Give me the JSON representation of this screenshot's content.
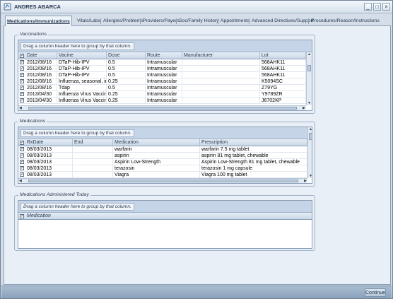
{
  "window": {
    "title": "ANDRES ABARCA",
    "minimize": "_",
    "maximize": "□",
    "close": "×"
  },
  "tabs": [
    {
      "label": "Medications/Immunizations",
      "active": true
    },
    {
      "label": "Vitals/Labs"
    },
    {
      "label": "Allergies/Problems"
    },
    {
      "label": "Providers/Payers"
    },
    {
      "label": "Soc/Family History"
    },
    {
      "label": "Appointments"
    },
    {
      "label": "Advanced Directives/Support"
    },
    {
      "label": "Procedures/Reason/Instructions"
    }
  ],
  "group_hint": "Drag a column header here to group by that column.",
  "vaccinations": {
    "title": "Vaccinations",
    "columns": [
      "Date",
      "Vacine",
      "Dose",
      "Route",
      "Manufacturer",
      "Lot"
    ],
    "rows": [
      [
        "2012/08/16",
        "DTaP-Hib-IPV",
        "0.5",
        "Intramuscular",
        "",
        "568AHK11"
      ],
      [
        "2012/08/16",
        "DTaP-Hib-IPV",
        "0.5",
        "Intramuscular",
        "",
        "568AHK11"
      ],
      [
        "2012/08/16",
        "DTaP-Hib-IPV",
        "0.5",
        "Intramuscular",
        "",
        "568AHK11"
      ],
      [
        "2012/08/16",
        "Influenza, seasonal, inje...",
        "0.25",
        "Intramuscular",
        "",
        "K5094SC"
      ],
      [
        "2012/08/16",
        "Tdap",
        "0.5",
        "Intramuscular",
        "",
        "Z79YG"
      ],
      [
        "2013/04/30",
        "Influenza Virus Vaccine -",
        "0.25",
        "Intramuscular",
        "",
        "Y9789ZR"
      ],
      [
        "2013/04/30",
        "Influenza Virus Vaccine -",
        "0.25",
        "Intramuscular",
        "",
        "J6702KP"
      ]
    ]
  },
  "medications": {
    "title": "Medications",
    "columns": [
      "RxDate",
      "End",
      "Medication",
      "Prescription"
    ],
    "rows": [
      [
        "08/03/2013",
        "",
        "warfarin",
        "warfarin 7.5 mg tablet"
      ],
      [
        "08/03/2013",
        "",
        "aspirin",
        "aspirin 81 mg tablet, chewable"
      ],
      [
        "08/03/2013",
        "",
        "Aspirin Low-Strength",
        "Aspirin Low-Strength 81 mg tablet, chewable"
      ],
      [
        "08/03/2013",
        "",
        "terazosin",
        "terazosin 1 mg capsule"
      ],
      [
        "08/03/2013",
        "",
        "Viagra",
        "Viagra 100 mg tablet"
      ]
    ]
  },
  "administered": {
    "title": "Medications Administered Today",
    "columns": [
      "Medication"
    ]
  },
  "footer": {
    "continue_label": "Continue"
  }
}
